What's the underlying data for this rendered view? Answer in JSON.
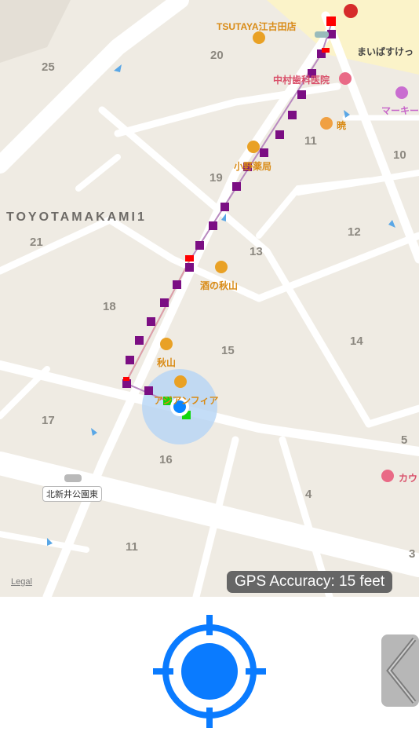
{
  "map": {
    "block_numbers": [
      "25",
      "20",
      "11",
      "10",
      "19",
      "21",
      "12",
      "13",
      "18",
      "15",
      "14",
      "17",
      "16",
      "5",
      "4",
      "11",
      "3"
    ],
    "area_name": "TOYOTAMAKAMI1",
    "pois": {
      "tsutaya": "TSUTAYA江古田店",
      "maibasuke": "まいばすけっ",
      "nakamura": "中村歯科医院",
      "marky": "マーキー",
      "akatsuki": "暁",
      "pharmacy": "小野薬局",
      "sake": "酒の秋山",
      "akiyama": "秋山",
      "asia": "アジアンフィア",
      "kau": "カウ"
    },
    "station": "北新井公園東",
    "legal": "Legal"
  },
  "status": {
    "gps_accuracy": "GPS Accuracy: 15 feet"
  },
  "colors": {
    "track_marker": "#7b0e83",
    "flag_red": "#ff0000",
    "flag_green": "#11d60e",
    "user_dot": "#0a84ff",
    "accuracy_circle": "#b5d4f5",
    "locate_icon": "#0a7bff"
  }
}
